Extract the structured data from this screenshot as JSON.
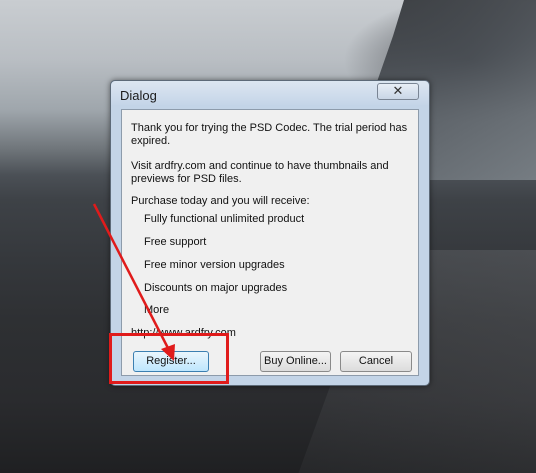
{
  "dialog": {
    "title": "Dialog",
    "close_glyph": "✕",
    "paragraph1_line1": "Thank you for trying the PSD Codec.  The trial period has",
    "paragraph1_line2": "expired.",
    "paragraph2_line1": "Visit ardfry.com and continue to have thumbnails and",
    "paragraph2_line2": "previews for PSD files.",
    "purchase_heading": "Purchase today and you will receive:",
    "benefits": [
      "Fully functional unlimited product",
      "Free support",
      "Free minor version upgrades",
      "Discounts on major upgrades",
      "More"
    ],
    "url": "http://www.ardfry.com",
    "buttons": {
      "register": "Register...",
      "buy_online": "Buy Online...",
      "cancel": "Cancel"
    }
  },
  "colors": {
    "annotation": "#e01b1b",
    "default_button_border": "#3c7fb1"
  }
}
